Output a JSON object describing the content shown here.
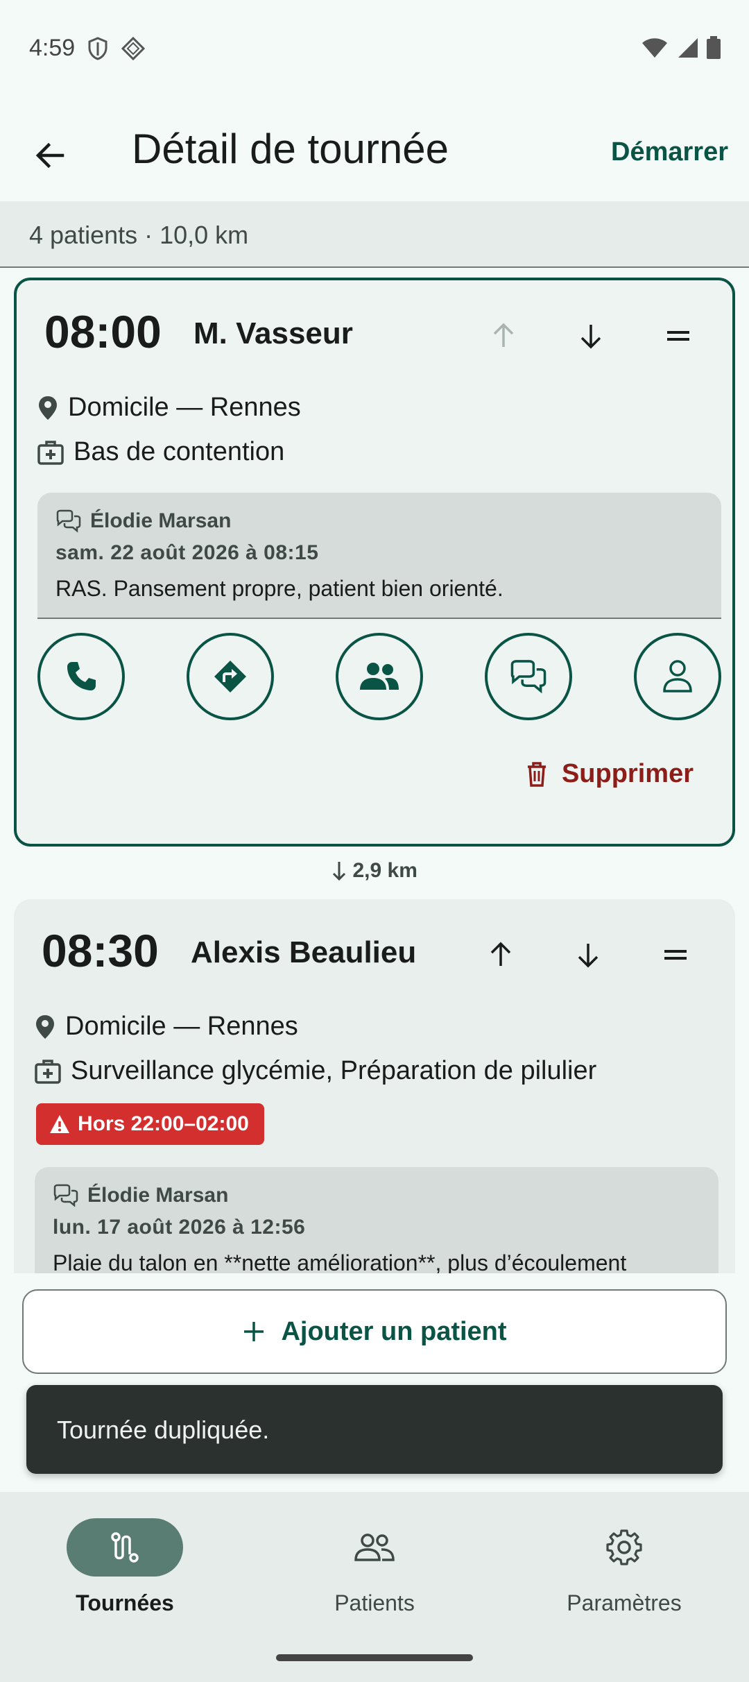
{
  "status_bar": {
    "time": "4:59"
  },
  "app_bar": {
    "title": "Détail de tournée",
    "start_label": "Démarrer"
  },
  "summary": "4 patients · 10,0 km",
  "visits": [
    {
      "time": "08:00",
      "name": "M. Vasseur",
      "location": "Domicile — Rennes",
      "care": "Bas de contention",
      "note": {
        "author": "Élodie Marsan",
        "date": "sam. 22 août 2026 à 08:15",
        "text": "RAS. Pansement propre, patient bien orienté."
      },
      "delete_label": "Supprimer",
      "distance_after": "2,9 km"
    },
    {
      "time": "08:30",
      "name": "Alexis Beaulieu",
      "location": "Domicile — Rennes",
      "care": "Surveillance glycémie, Préparation de pilulier",
      "warning": "Hors 22:00–02:00",
      "note": {
        "author": "Élodie Marsan",
        "date": "lun. 17 août 2026 à 12:56",
        "text": "Plaie du talon en **nette amélioration**, plus d’écoulement"
      }
    }
  ],
  "add_patient_label": "Ajouter un patient",
  "snackbar": "Tournée dupliquée.",
  "nav": [
    {
      "label": "Tournées",
      "icon": "route-icon",
      "active": true
    },
    {
      "label": "Patients",
      "icon": "group-icon",
      "active": false
    },
    {
      "label": "Paramètres",
      "icon": "gear-icon",
      "active": false
    }
  ],
  "colors": {
    "primary": "#0a5446",
    "danger": "#8c1d18",
    "warning": "#d32f2f",
    "background": "#f3faf8"
  }
}
